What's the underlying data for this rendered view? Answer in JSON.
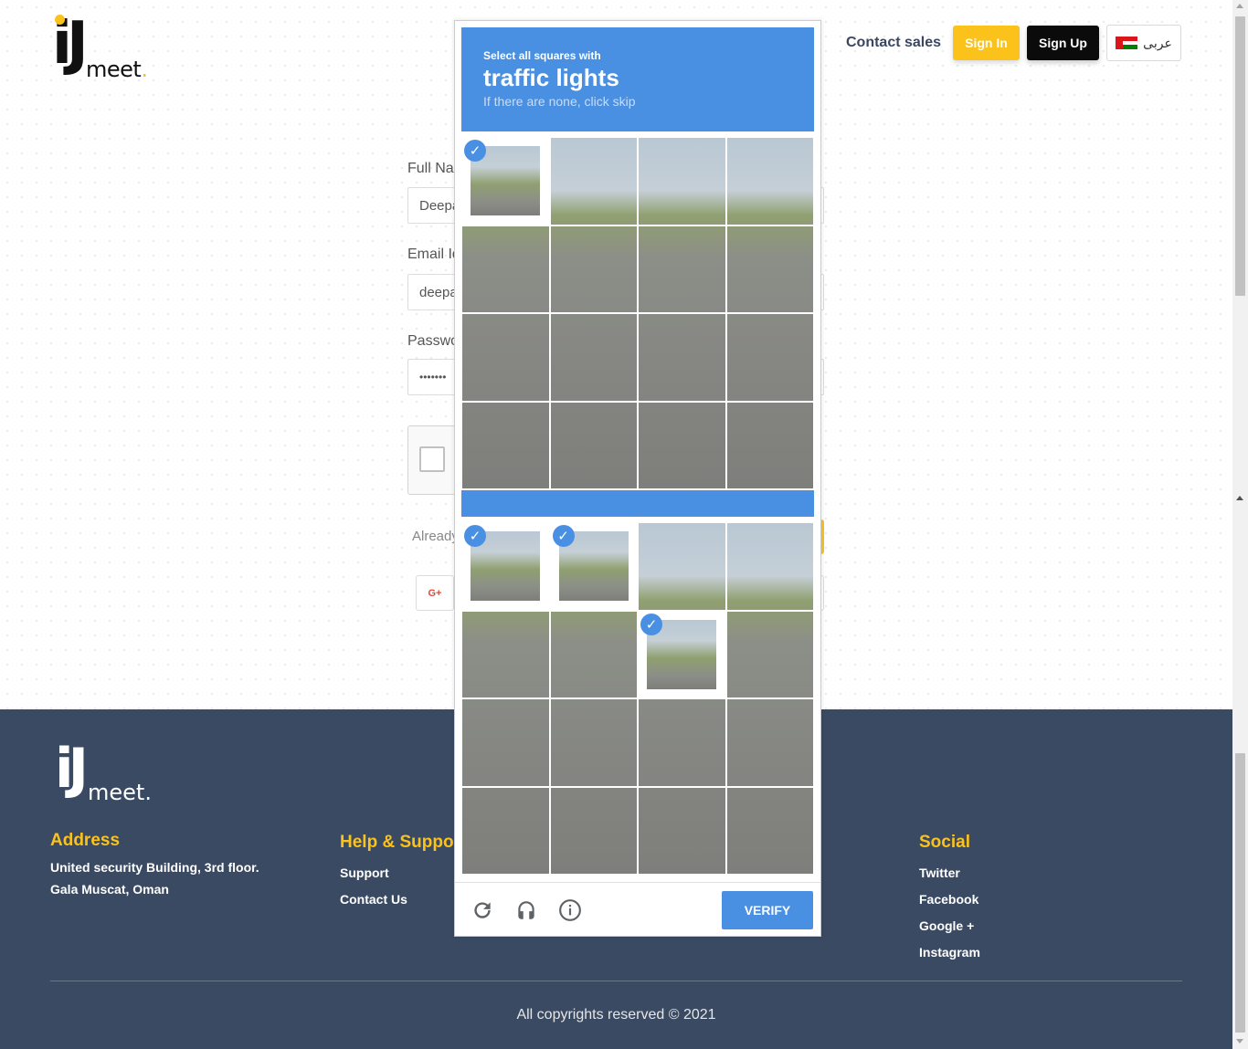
{
  "header": {
    "logo_main": "iJ",
    "logo_sub": "meet",
    "logo_dot": ".",
    "contact_sales": "Contact sales",
    "sign_in": "Sign In",
    "sign_up": "Sign Up",
    "language": "عربى"
  },
  "form": {
    "full_name_label": "Full Na",
    "full_name_value": "Deepa",
    "email_label": "Email Id",
    "email_value": "deepa",
    "password_label": "Passwo",
    "password_value": "•••••••",
    "already_text": "Already",
    "google_label": "G+"
  },
  "captcha": {
    "instruction_small": "Select all squares with",
    "target": "traffic lights",
    "hint": "If there are none, click skip",
    "verify_label": "VERIFY",
    "icons": [
      "reload-icon",
      "audio-icon",
      "info-icon"
    ],
    "accent_color": "#4a90e2",
    "grid1_selected": [
      0
    ],
    "grid2_selected": [
      0,
      1,
      6
    ]
  },
  "footer": {
    "address_title": "Address",
    "address_line1": "United security Building, 3rd floor.",
    "address_line2": "Gala Muscat, Oman",
    "help_title": "Help & Suppor",
    "help_items": [
      "Support",
      "Contact Us"
    ],
    "social_title": "Social",
    "social_items": [
      "Twitter",
      "Facebook",
      "Google +",
      "Instagram"
    ],
    "copyright": "All copyrights reserved © 2021"
  },
  "colors": {
    "brand_yellow": "#fbc21b",
    "footer_bg": "#3a4a63"
  }
}
